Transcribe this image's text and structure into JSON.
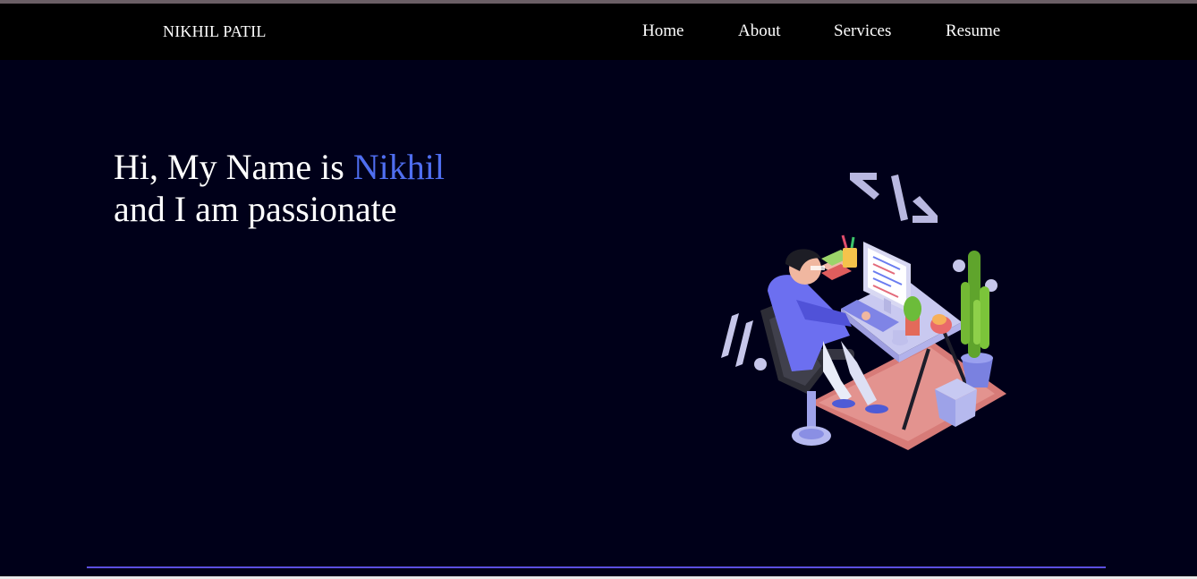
{
  "brand": {
    "name": "NIKHIL PATIL"
  },
  "nav": {
    "items": [
      {
        "label": "Home"
      },
      {
        "label": "About"
      },
      {
        "label": "Services"
      },
      {
        "label": "Resume"
      }
    ]
  },
  "hero": {
    "line1_prefix": "Hi, My Name is ",
    "line1_name": "Nikhil",
    "line2": "and I am passionate",
    "illustration_icon": "developer-at-desk-illustration"
  },
  "colors": {
    "background": "#000019",
    "navbar": "#000000",
    "accent": "#4f6ef0",
    "divider": "#5b4fe0"
  }
}
